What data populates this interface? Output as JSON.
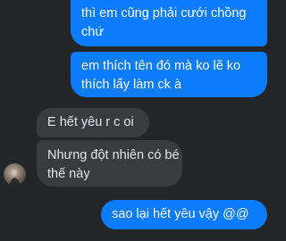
{
  "messages": [
    {
      "side": "sent",
      "lines": [
        "thì em cũng phải cưới chồng",
        "chứ"
      ]
    },
    {
      "side": "sent",
      "lines": [
        "em thích tên đó mà ko lẽ ko",
        "thích lấy làm ck à"
      ]
    },
    {
      "side": "received",
      "lines": [
        "E hết yêu r c oi"
      ]
    },
    {
      "side": "received",
      "lines": [
        "Nhưng đột nhiên có bé",
        "thế này"
      ]
    },
    {
      "side": "sent",
      "lines": [
        "sao lại hết yêu vậy @@"
      ]
    }
  ],
  "contact": {
    "avatar_icon": "contact-avatar"
  },
  "colors": {
    "background": "#242526",
    "sent_bubble": "#0a7cff",
    "received_bubble": "#3a3b3c",
    "received_text": "#e4e6eb"
  }
}
